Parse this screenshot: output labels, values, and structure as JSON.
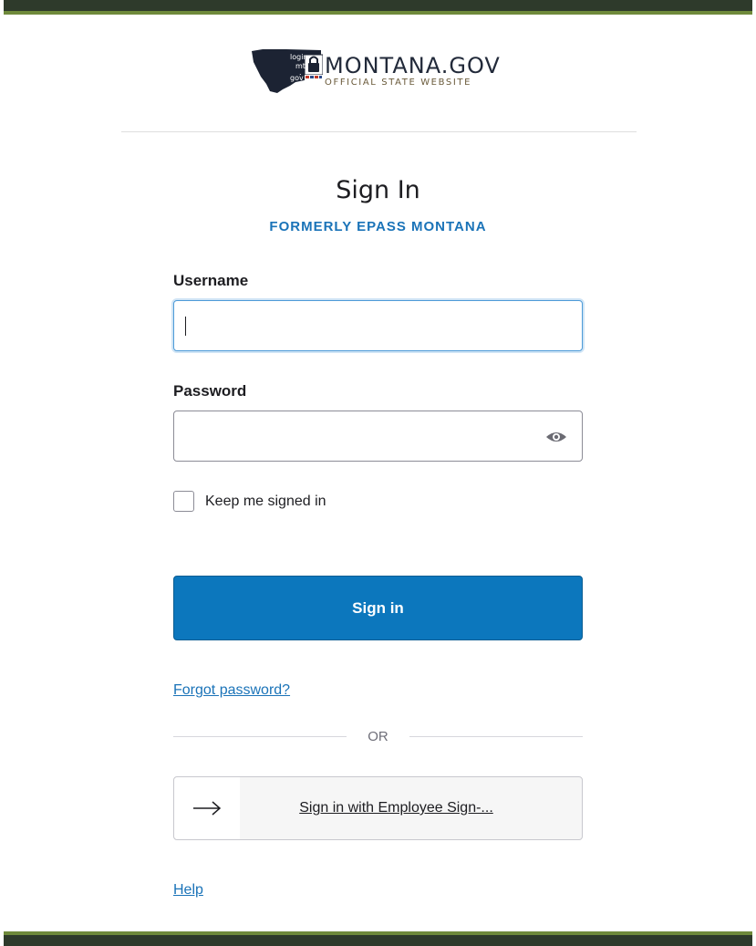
{
  "logo": {
    "mark_lines": [
      "login",
      "mt",
      ".",
      "gov"
    ],
    "title": "MONTANA.GOV",
    "subtitle": "OFFICIAL STATE WEBSITE"
  },
  "form": {
    "title": "Sign In",
    "subtitle": "FORMERLY EPASS MONTANA",
    "username_label": "Username",
    "username_value": "",
    "password_label": "Password",
    "password_value": "",
    "keep_signed_in_label": "Keep me signed in",
    "sign_in_button": "Sign in",
    "forgot_password_link": "Forgot password?",
    "or_text": "OR",
    "employee_signin_button": "Sign in with Employee Sign-...",
    "help_link": "Help"
  },
  "icons": {
    "password_toggle": "eye-icon",
    "employee_signin": "arrow-right-icon",
    "logo_lock": "lock-icon"
  },
  "colors": {
    "accent": "#0c77bd",
    "subtitle": "#1a73b8",
    "header_bar": "#2e3a2b",
    "header_stripe": "#6f8a3b"
  }
}
